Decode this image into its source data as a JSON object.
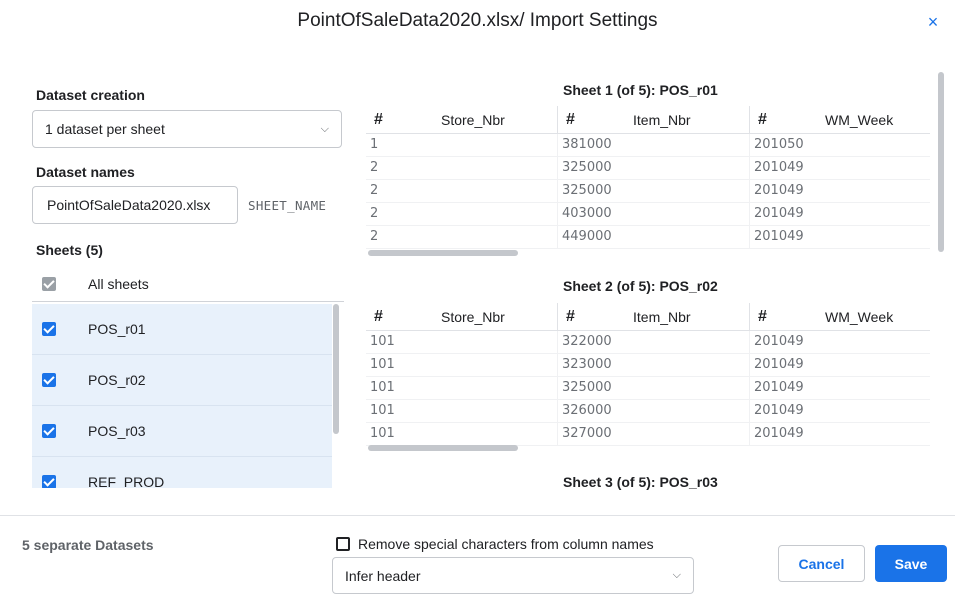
{
  "dialog": {
    "title": "PointOfSaleData2020.xlsx/ Import Settings",
    "close_icon": "×"
  },
  "dataset_creation": {
    "label": "Dataset creation",
    "selected": "1 dataset per sheet"
  },
  "dataset_names": {
    "label": "Dataset names",
    "value": "PointOfSaleData2020.xlsx",
    "suffix": "SHEET_NAME"
  },
  "sheets": {
    "label": "Sheets (5)",
    "all_label": "All sheets",
    "items": [
      {
        "label": "POS_r01",
        "checked": true
      },
      {
        "label": "POS_r02",
        "checked": true
      },
      {
        "label": "POS_r03",
        "checked": true
      },
      {
        "label": "REF_PROD",
        "checked": true
      }
    ]
  },
  "previews": [
    {
      "title": "Sheet 1 (of 5): POS_r01",
      "columns": [
        {
          "type_icon": "#",
          "name": "Store_Nbr"
        },
        {
          "type_icon": "#",
          "name": "Item_Nbr"
        },
        {
          "type_icon": "#",
          "name": "WM_Week"
        }
      ],
      "rows": [
        [
          "1",
          "381000",
          "201050"
        ],
        [
          "2",
          "325000",
          "201049"
        ],
        [
          "2",
          "325000",
          "201049"
        ],
        [
          "2",
          "403000",
          "201049"
        ],
        [
          "2",
          "449000",
          "201049"
        ]
      ]
    },
    {
      "title": "Sheet 2 (of 5): POS_r02",
      "columns": [
        {
          "type_icon": "#",
          "name": "Store_Nbr"
        },
        {
          "type_icon": "#",
          "name": "Item_Nbr"
        },
        {
          "type_icon": "#",
          "name": "WM_Week"
        }
      ],
      "rows": [
        [
          "101",
          "322000",
          "201049"
        ],
        [
          "101",
          "323000",
          "201049"
        ],
        [
          "101",
          "325000",
          "201049"
        ],
        [
          "101",
          "326000",
          "201049"
        ],
        [
          "101",
          "327000",
          "201049"
        ]
      ]
    },
    {
      "title": "Sheet 3 (of 5): POS_r03"
    }
  ],
  "footer": {
    "count": "5 separate Datasets",
    "remove_special": "Remove special characters from column names",
    "header_mode": "Infer header",
    "cancel": "Cancel",
    "save": "Save"
  },
  "colors": {
    "accent": "#1a73e8",
    "selected_row": "#e8f1fb"
  }
}
